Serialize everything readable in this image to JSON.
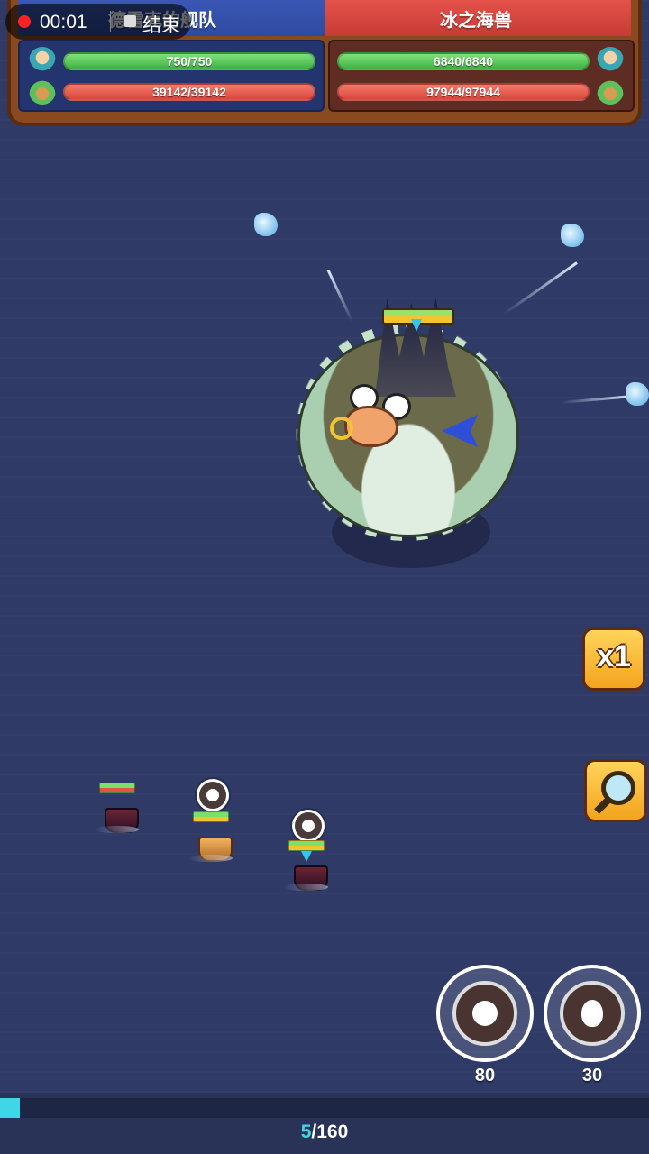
{
  "recording": {
    "time": "00:01",
    "end_label": "结束"
  },
  "hud": {
    "left_team": {
      "name": "德雷克的舰队",
      "crew_hp": "750/750",
      "ship_hp": "39142/39142"
    },
    "right_team": {
      "name": "冰之海兽",
      "crew_hp": "6840/6840",
      "ship_hp": "97944/97944"
    }
  },
  "controls": {
    "speed_label": "x1"
  },
  "skills": [
    {
      "icon": "fish-skill-icon",
      "cost": "80"
    },
    {
      "icon": "egg-skill-icon",
      "cost": "30"
    }
  ],
  "wave": {
    "current": "5",
    "total": "/160",
    "progress_fraction": 0.031
  },
  "colors": {
    "accent_cyan": "#3fd7e8",
    "team_blue": "#3a57b5",
    "team_red": "#e4524a"
  }
}
